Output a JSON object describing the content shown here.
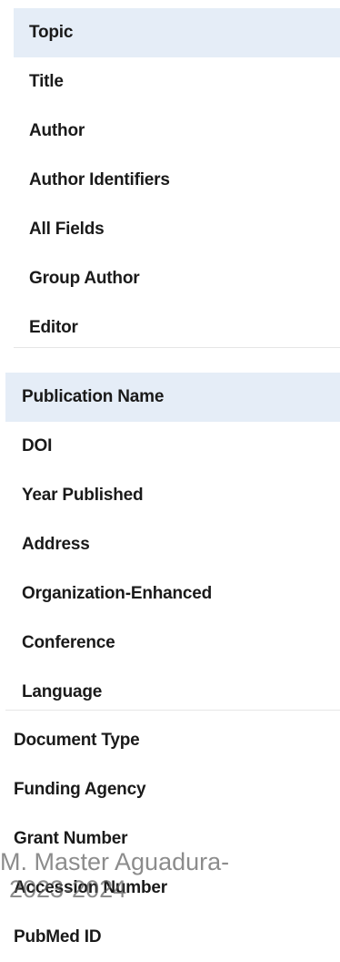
{
  "groups": [
    {
      "items": [
        {
          "label": "Topic",
          "highlighted": true
        },
        {
          "label": "Title"
        },
        {
          "label": "Author"
        },
        {
          "label": "Author Identifiers"
        },
        {
          "label": "All Fields"
        },
        {
          "label": "Group Author"
        },
        {
          "label": "Editor"
        }
      ]
    },
    {
      "items": [
        {
          "label": "Publication Name",
          "highlighted": true
        },
        {
          "label": "DOI"
        },
        {
          "label": "Year Published"
        },
        {
          "label": "Address"
        },
        {
          "label": "Organization-Enhanced"
        },
        {
          "label": "Conference"
        },
        {
          "label": "Language"
        }
      ]
    },
    {
      "items": [
        {
          "label": "Document Type"
        },
        {
          "label": "Funding Agency"
        },
        {
          "label": "Grant Number"
        },
        {
          "label": "Accession Number"
        },
        {
          "label": "PubMed ID"
        }
      ]
    }
  ],
  "watermark": {
    "line1": "M. Master Aguadura-",
    "line2": "2023-2024"
  },
  "colors": {
    "highlight": "#e5edf7",
    "text": "#1a1a1a",
    "divider": "#e6e6e6"
  }
}
